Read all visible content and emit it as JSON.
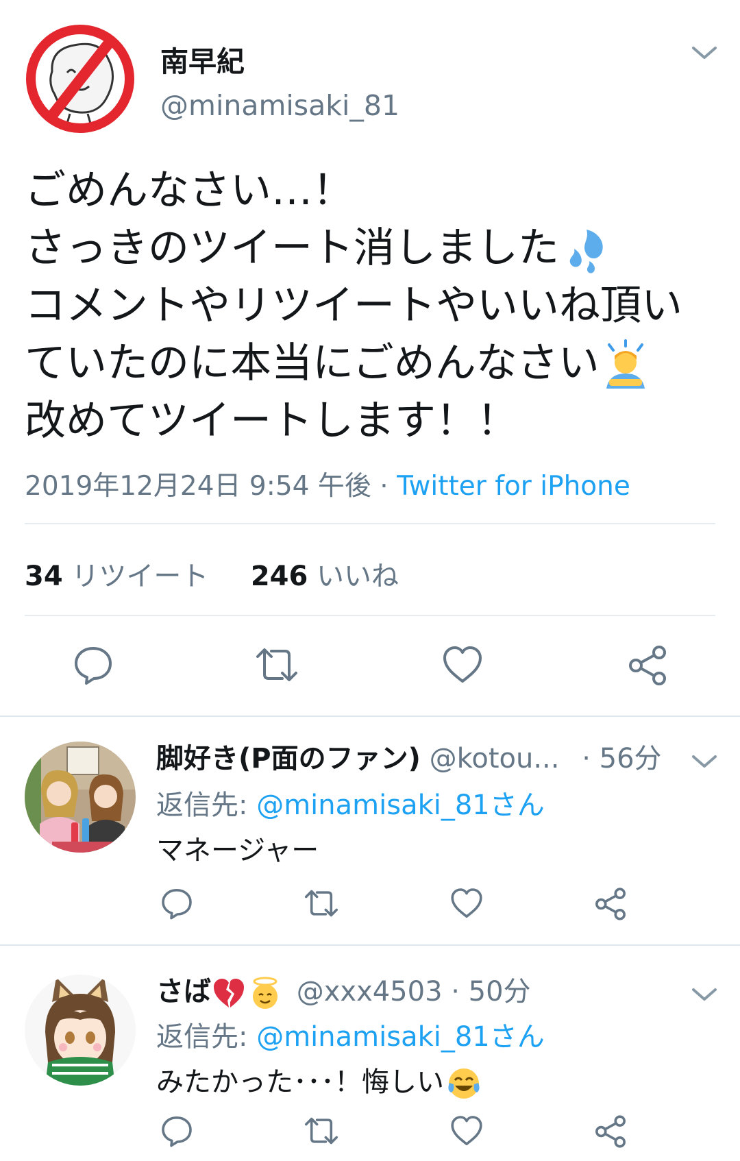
{
  "main_tweet": {
    "display_name": "南早紀",
    "handle": "@minamisaki_81",
    "lines": [
      "ごめんなさい…！",
      "さっきのツイート消しました",
      "コメントやリツイートやいいね頂い",
      "ていたのに本当にごめんなさい",
      "改めてツイートします！！"
    ],
    "timestamp": "2019年12月24日 9:54 午後",
    "meta_separator": "·",
    "source": "Twitter for iPhone",
    "retweet_count": "34",
    "retweet_label": "リツイート",
    "like_count": "246",
    "like_label": "いいね",
    "icons": {
      "avatar": "crossed-out-character-avatar",
      "emoji_1": "sweat-droplets-emoji",
      "emoji_2": "bowing-person-emoji",
      "menu": "chevron-down-icon",
      "reply": "reply-icon",
      "retweet": "retweet-icon",
      "like": "heart-icon",
      "share": "share-icon"
    }
  },
  "replies": [
    {
      "display_name": "脚好き(P面のファン)",
      "handle": "@kotou...",
      "time": "· 56分",
      "reply_to_label": "返信先:",
      "reply_to_handle": "@minamisaki_81さん",
      "text": "マネージャー",
      "avatar": "anime-girls-avatar"
    },
    {
      "display_name": "さば",
      "handle": "@xxx4503",
      "time": "· 50分",
      "reply_to_label": "返信先:",
      "reply_to_handle": "@minamisaki_81さん",
      "text": "みたかった･･･！悔しい",
      "avatar": "anime-catgirl-avatar",
      "name_emojis": [
        "broken-heart-emoji",
        "angel-face-emoji"
      ],
      "text_emoji": "tears-of-joy-emoji"
    }
  ],
  "colors": {
    "text": "#14171a",
    "muted": "#657786",
    "link": "#1da1f2",
    "divider": "#e6ecf0",
    "icon": "#657786"
  }
}
